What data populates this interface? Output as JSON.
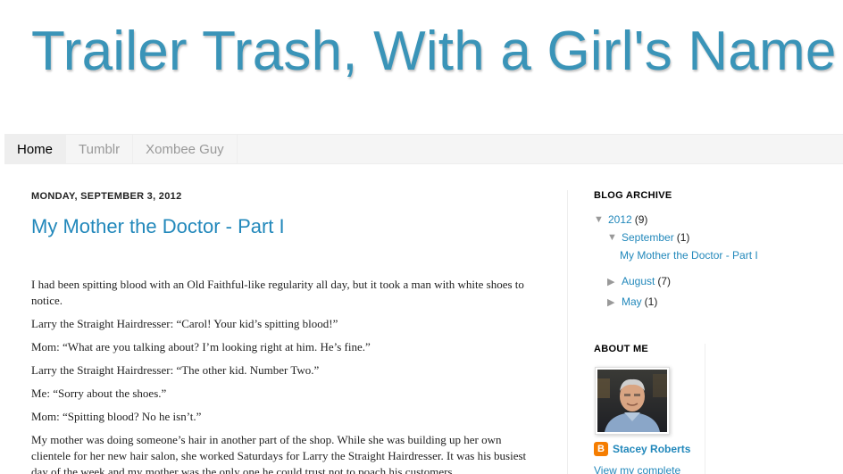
{
  "header": {
    "title": "Trailer Trash, With a Girl's Name"
  },
  "tabs": [
    {
      "label": "Home"
    },
    {
      "label": "Tumblr"
    },
    {
      "label": "Xombee Guy"
    }
  ],
  "post": {
    "date": "MONDAY, SEPTEMBER 3, 2012",
    "title": "My Mother the Doctor - Part I",
    "paragraphs": [
      "I had been spitting blood with an Old Faithful-like regularity all day, but it took a man with white shoes to notice.",
      "Larry the Straight Hairdresser: “Carol! Your kid’s spitting blood!”",
      "Mom: “What are you talking about? I’m looking right at him. He’s fine.”",
      "Larry the Straight Hairdresser: “The other kid. Number Two.”",
      "Me: “Sorry about the shoes.”",
      "Mom: “Spitting blood? No he isn’t.”",
      "My mother was doing someone’s hair in another part of the shop. While she was building up her own clientele for her new hair salon, she worked Saturdays for Larry the Straight Hairdresser. It was his busiest day of the week and my mother was the only one he could trust not to poach his customers."
    ]
  },
  "sidebar": {
    "archive_title": "BLOG ARCHIVE",
    "year": {
      "label": "2012",
      "count": "(9)"
    },
    "months": [
      {
        "label": "September",
        "count": "(1)",
        "expanded": true
      },
      {
        "label": "August",
        "count": "(7)",
        "expanded": false
      },
      {
        "label": "May",
        "count": "(1)",
        "expanded": false
      }
    ],
    "september_post": "My Mother the Doctor - Part I",
    "about_title": "ABOUT ME",
    "author": "Stacey Roberts",
    "view_profile": "View my complete"
  },
  "colors": {
    "title": "#3a94b8",
    "link": "#2288bb",
    "blogger": "#f57d00"
  }
}
